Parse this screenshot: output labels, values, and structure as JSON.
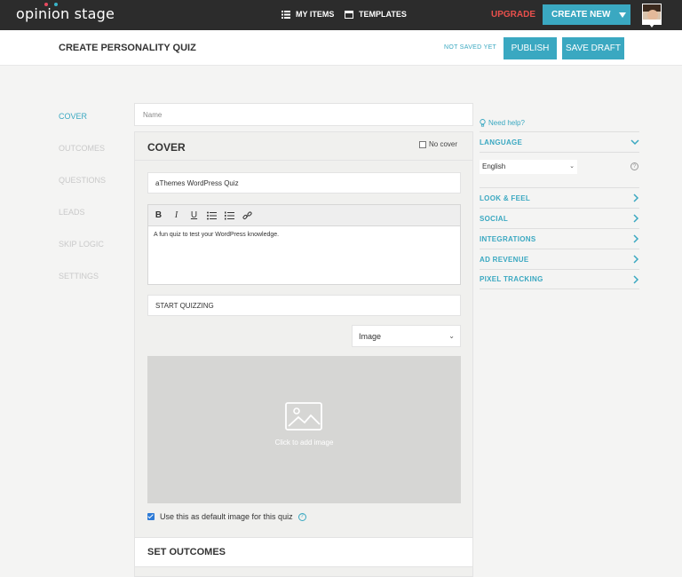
{
  "header": {
    "logo": "opinion stage",
    "nav": [
      {
        "label": "MY ITEMS",
        "icon": "list-icon"
      },
      {
        "label": "TEMPLATES",
        "icon": "template-icon"
      }
    ],
    "upgrade": "UPGRADE",
    "create_new": "CREATE NEW",
    "colors": {
      "bar": "#2c2c2c",
      "accent": "#3aa8c1",
      "upgrade": "#e8504c"
    }
  },
  "subheader": {
    "title": "CREATE PERSONALITY QUIZ",
    "status": "NOT SAVED YET",
    "publish": "PUBLISH",
    "save_draft": "SAVE DRAFT"
  },
  "sidebar": {
    "items": [
      {
        "label": "COVER",
        "active": true
      },
      {
        "label": "OUTCOMES",
        "active": false
      },
      {
        "label": "QUESTIONS",
        "active": false
      },
      {
        "label": "LEADS",
        "active": false
      },
      {
        "label": "SKIP LOGIC",
        "active": false
      },
      {
        "label": "SETTINGS",
        "active": false
      }
    ]
  },
  "main": {
    "name_placeholder": "Name",
    "cover": {
      "title": "COVER",
      "no_cover_label": "No cover",
      "quiz_title": "aThemes WordPress Quiz",
      "description": "A fun quiz to test your WordPress knowledge.",
      "button_text": "START QUIZZING",
      "media_type": "Image",
      "image_placeholder": "Click to add image",
      "default_image_label": "Use this as default image for this quiz",
      "default_image_checked": true
    },
    "outcomes_title": "SET OUTCOMES"
  },
  "right_panel": {
    "need_help": "Need help?",
    "language_label": "LANGUAGE",
    "language_value": "English",
    "sections": [
      "LOOK & FEEL",
      "SOCIAL",
      "INTEGRATIONS",
      "AD REVENUE",
      "PIXEL TRACKING"
    ]
  }
}
